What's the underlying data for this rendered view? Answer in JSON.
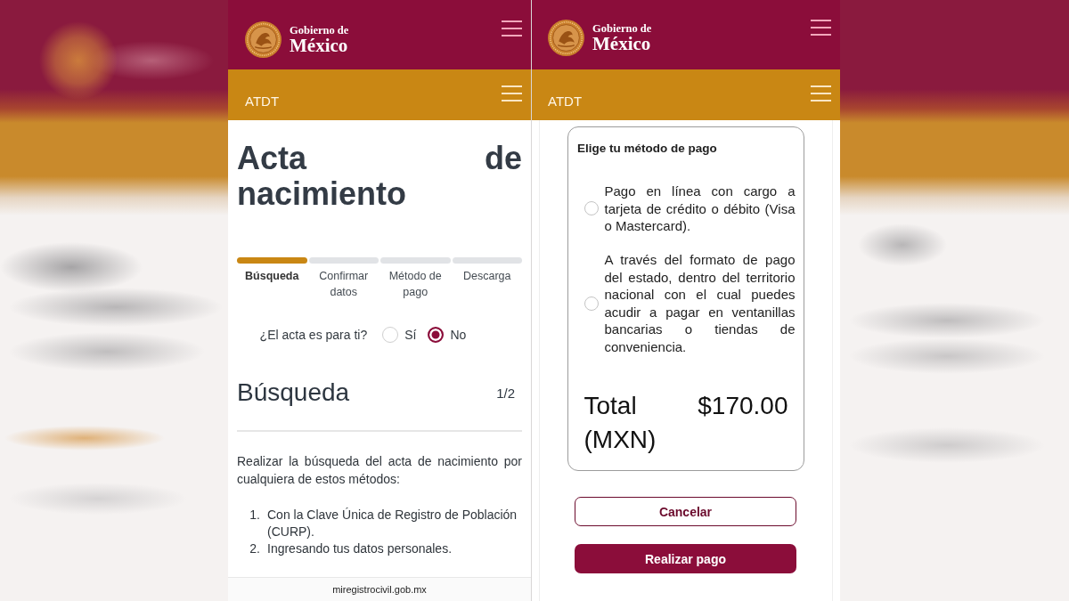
{
  "search_screen": {
    "header": {
      "caption": "Gobierno de",
      "wordmark": "México"
    },
    "agency_bar": {
      "name": "ATDT"
    },
    "title": "Acta de nacimiento",
    "steps": [
      {
        "label": "Búsqueda",
        "active": true
      },
      {
        "label": "Confirmar datos",
        "active": false
      },
      {
        "label": "Método de pago",
        "active": false
      },
      {
        "label": "Descarga",
        "active": false
      }
    ],
    "question": {
      "label": "¿El acta es para ti?",
      "options": [
        {
          "label": "Sí",
          "selected": false
        },
        {
          "label": "No",
          "selected": true
        }
      ]
    },
    "section": {
      "title": "Búsqueda",
      "counter": "1/2"
    },
    "intro": "Realizar la búsqueda del acta de nacimiento por cualquiera de estos métodos:",
    "methods": [
      {
        "number": "1.",
        "text": "Con la Clave Única de Registro de Población (CURP)."
      },
      {
        "number": "2.",
        "text": "Ingresando tus datos personales."
      }
    ],
    "address_bar": {
      "url": "miregistrocivil.gob.mx"
    }
  },
  "payment_screen": {
    "header": {
      "caption": "Gobierno de",
      "wordmark": "México"
    },
    "agency_bar": {
      "name": "ATDT"
    },
    "payment_card": {
      "title": "Elige tu método de pago",
      "options": [
        {
          "text": "Pago en línea con cargo a tarjeta de crédito o débito (Visa o Mastercard).",
          "selected": false
        },
        {
          "text": "A través del formato de pago del estado, dentro del territorio nacional con el cual puedes acudir a pagar en ventanillas bancarias o tiendas de conveniencia.",
          "selected": false
        }
      ],
      "total_label": "Total (MXN)",
      "total_amount": "$170.00"
    },
    "buttons": [
      {
        "label": "Cancelar",
        "kind": "outline"
      },
      {
        "label": "Realizar pago",
        "kind": "filled"
      }
    ]
  }
}
